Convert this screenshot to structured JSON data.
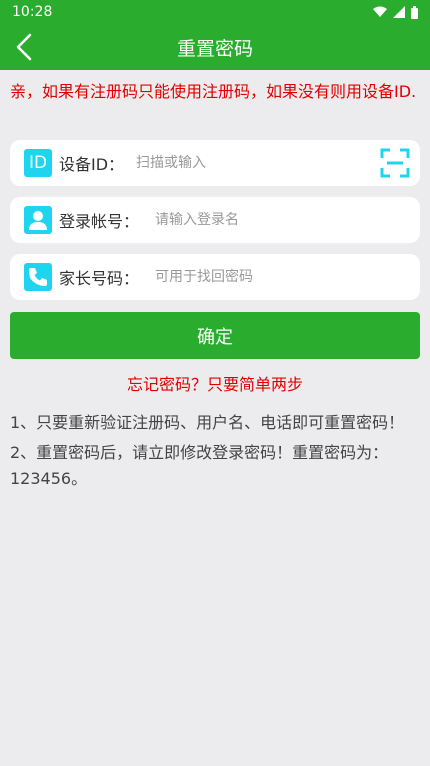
{
  "status_bar": {
    "time": "10:28"
  },
  "header": {
    "title": "重置密码"
  },
  "notice": "亲，如果有注册码只能使用注册码，如果没有则用设备ID.",
  "form": {
    "device_id": {
      "icon_text": "ID",
      "label": "设备ID：",
      "placeholder": "扫描或输入"
    },
    "account": {
      "label": "登录帐号：",
      "placeholder": "请输入登录名"
    },
    "phone": {
      "label": "家长号码：",
      "placeholder": "可用于找回密码"
    }
  },
  "confirm_label": "确定",
  "hint": "忘记密码？只要简单两步",
  "tips": [
    "1、只要重新验证注册码、用户名、电话即可重置密码！",
    "2、重置密码后，请立即修改登录密码！重置密码为：123456。"
  ],
  "colors": {
    "primary": "#2aad2e",
    "alert": "#e00000",
    "icon": "#1fd4ee",
    "background": "#ececee"
  }
}
